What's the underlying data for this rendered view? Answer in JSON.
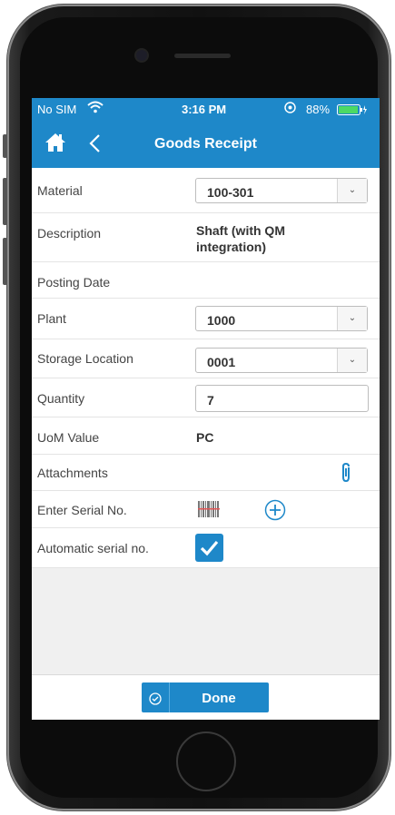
{
  "status_bar": {
    "carrier": "No SIM",
    "time": "3:16 PM",
    "battery": "88%"
  },
  "nav": {
    "title": "Goods Receipt",
    "home_icon": "home-icon",
    "back_icon": "chevron-left-icon"
  },
  "form": {
    "material": {
      "label": "Material",
      "value": "100-301"
    },
    "description": {
      "label": "Description",
      "value_line1": "Shaft (with QM",
      "value_line2": "integration)"
    },
    "posting_date": {
      "label": "Posting Date"
    },
    "plant": {
      "label": "Plant",
      "value": "1000"
    },
    "storage_location": {
      "label": "Storage Location",
      "value": "0001"
    },
    "quantity": {
      "label": "Quantity",
      "value": "7"
    },
    "uom": {
      "label": "UoM Value",
      "value": "PC"
    },
    "attachments": {
      "label": "Attachments",
      "icon": "paperclip-icon"
    },
    "serial_no": {
      "label": "Enter Serial No.",
      "scan_icon": "barcode-icon",
      "add_icon": "plus-circle-icon"
    },
    "auto_serial": {
      "label": "Automatic serial no.",
      "checked": true
    }
  },
  "footer": {
    "done_label": "Done",
    "done_icon": "check-circle-icon"
  },
  "colors": {
    "accent": "#1e88c9",
    "background": "#f0f0f0"
  }
}
